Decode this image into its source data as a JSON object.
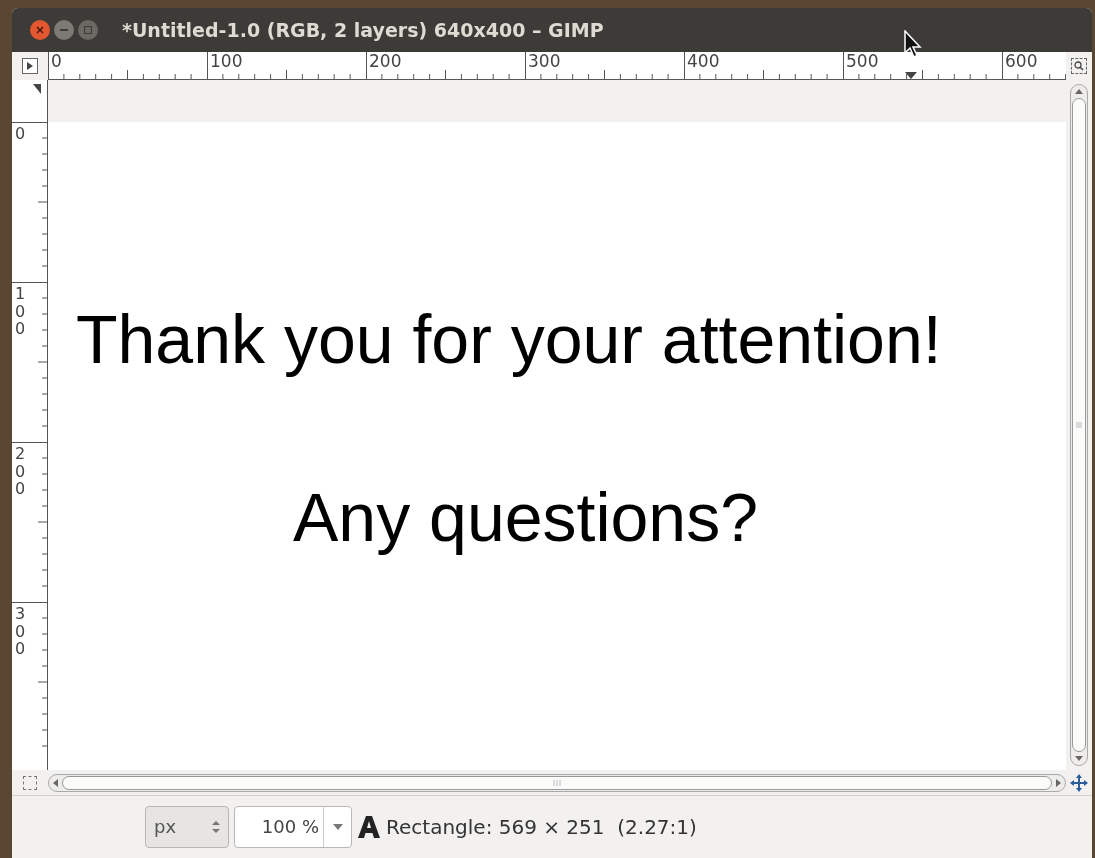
{
  "window": {
    "title": "*Untitled-1.0 (RGB, 2 layers) 640x400 – GIMP"
  },
  "rulers": {
    "horizontal": [
      "0",
      "100",
      "200",
      "300",
      "400",
      "500",
      "600"
    ],
    "vertical": [
      "0",
      "100",
      "200",
      "300"
    ]
  },
  "canvas": {
    "lines": [
      "Thank you for your attention!",
      "Any questions?"
    ]
  },
  "status_bar": {
    "unit": "px",
    "zoom": "100 %",
    "message": "Rectangle: 569 × 251  (2.27:1)"
  }
}
